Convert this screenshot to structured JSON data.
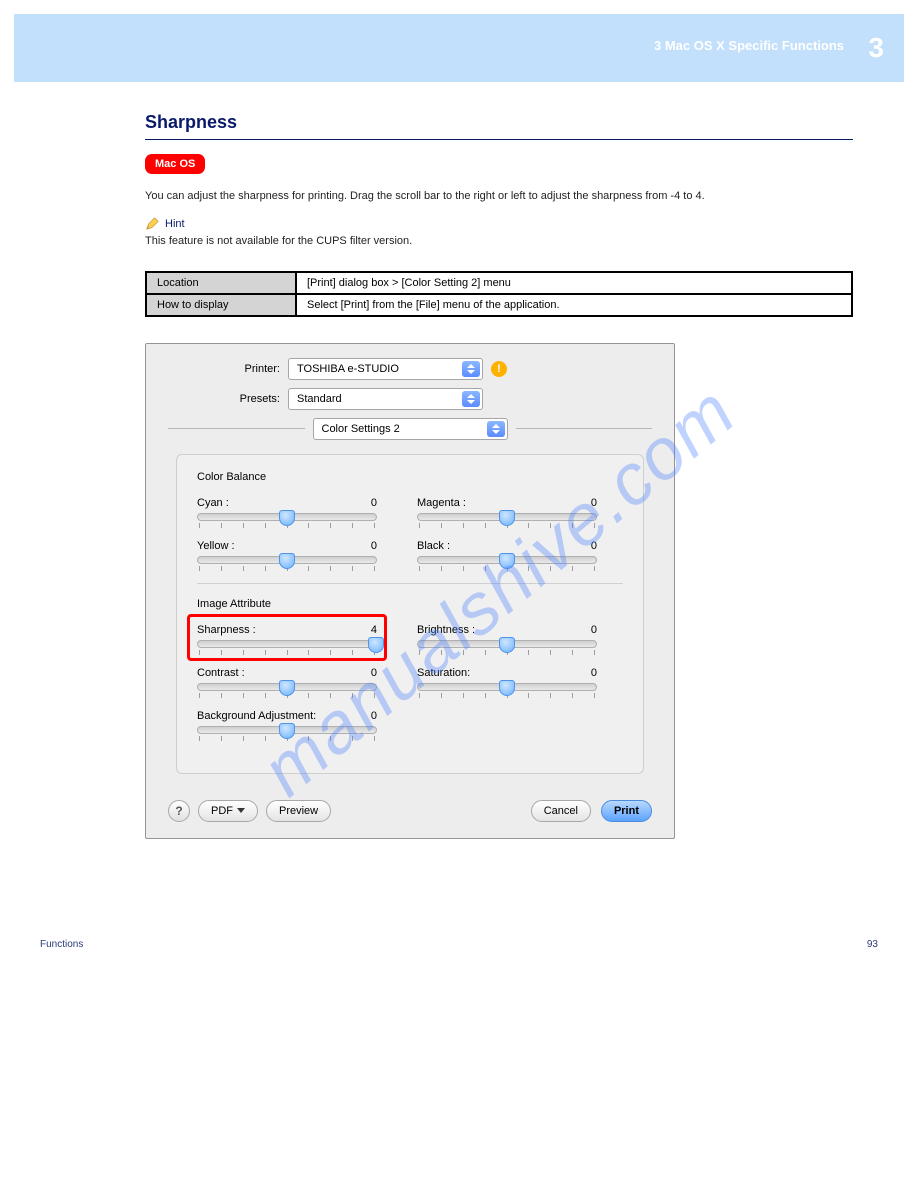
{
  "header": {
    "number": "3",
    "text": "3 Mac OS X Specific Functions"
  },
  "section_title": "Sharpness",
  "platform_badge": "Mac OS",
  "body_paragraph": "You can adjust the sharpness for printing. Drag the scroll bar to the right or left to adjust the sharpness from -4 to 4.",
  "hint": {
    "label": "Hint",
    "text": "This feature is not available for the CUPS filter version."
  },
  "table": {
    "row1": {
      "label": "Location",
      "value": "[Print] dialog box > [Color Setting 2] menu"
    },
    "row2": {
      "label": "How to display",
      "value": "Select [Print] from the [File] menu of the application."
    }
  },
  "dialog": {
    "printer": {
      "label": "Printer:",
      "value": "TOSHIBA e-STUDIO"
    },
    "presets": {
      "label": "Presets:",
      "value": "Standard"
    },
    "panel_menu": "Color Settings 2",
    "color_balance_title": "Color Balance",
    "image_attribute_title": "Image Attribute",
    "sliders": {
      "cyan": {
        "label": "Cyan :",
        "value": "0",
        "pos": 50
      },
      "magenta": {
        "label": "Magenta :",
        "value": "0",
        "pos": 50
      },
      "yellow": {
        "label": "Yellow :",
        "value": "0",
        "pos": 50
      },
      "black": {
        "label": "Black :",
        "value": "0",
        "pos": 50
      },
      "sharpness": {
        "label": "Sharpness :",
        "value": "4",
        "pos": 100
      },
      "brightness": {
        "label": "Brightness :",
        "value": "0",
        "pos": 50
      },
      "contrast": {
        "label": "Contrast :",
        "value": "0",
        "pos": 50
      },
      "saturation": {
        "label": "Saturation:",
        "value": "0",
        "pos": 50
      },
      "background": {
        "label": "Background Adjustment:",
        "value": "0",
        "pos": 50
      }
    },
    "buttons": {
      "help": "?",
      "pdf": "PDF",
      "preview": "Preview",
      "cancel": "Cancel",
      "print": "Print"
    }
  },
  "footer": {
    "left": "Functions",
    "right": "93"
  },
  "watermark": "manualshive.com"
}
